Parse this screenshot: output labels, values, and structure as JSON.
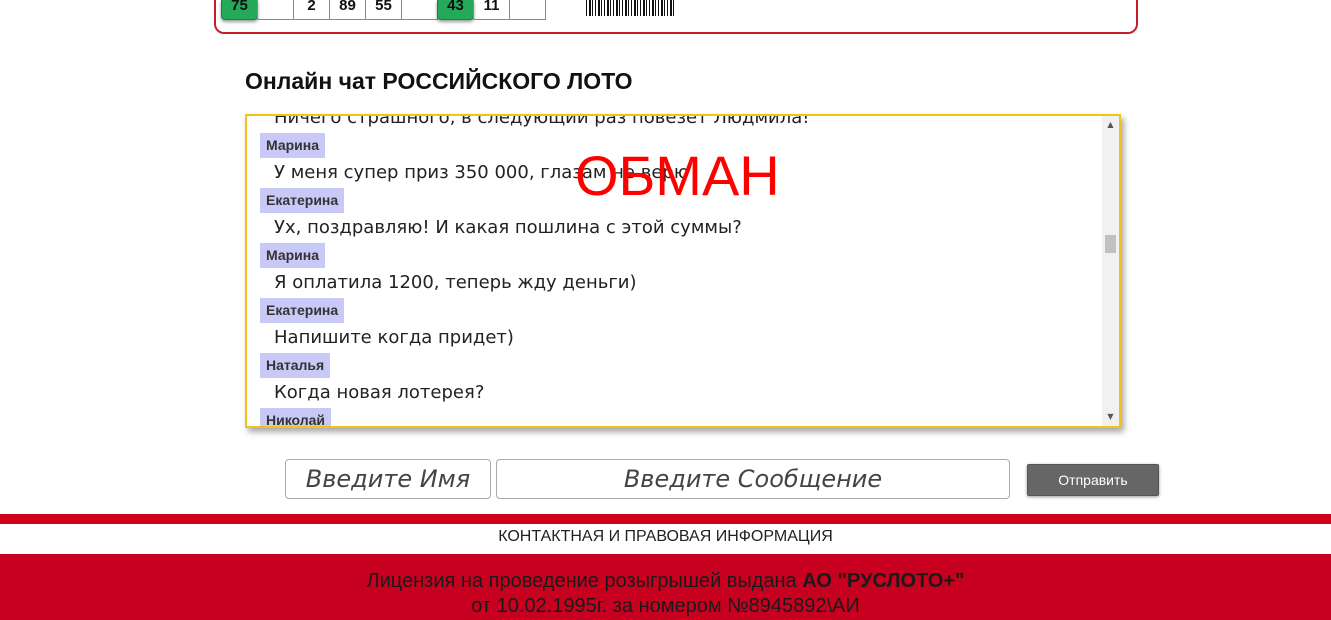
{
  "ticket": {
    "cells": [
      "75",
      "",
      "2",
      "89",
      "55",
      "",
      "43",
      "11",
      ""
    ],
    "hit_cells": [
      0,
      6
    ]
  },
  "chat": {
    "title": "Онлайн чат РОССИЙСКОГО ЛОТО",
    "first_text": "Ничего страшного, в следующий раз повезет Людмила!",
    "messages": [
      {
        "author": "Марина",
        "text": "У меня супер приз 350 000, глазам не верю"
      },
      {
        "author": "Екатерина",
        "text": "Ух, поздравляю! И какая пошлина с этой суммы?"
      },
      {
        "author": "Марина",
        "text": "Я оплатила 1200, теперь жду деньги)"
      },
      {
        "author": "Екатерина",
        "text": "Напишите когда придет)"
      },
      {
        "author": "Наталья",
        "text": "Когда новая лотерея?"
      },
      {
        "author": "Николай",
        "text": ""
      }
    ],
    "watermark": "ОБМАН",
    "author_bg": "#c9c9f7",
    "border_color": "#f2c21b"
  },
  "form": {
    "name_placeholder": "Введите Имя",
    "message_placeholder": "Введите Сообщение",
    "send_label": "Отправить"
  },
  "footer": {
    "contact_link": "КОНТАКТНАЯ И ПРАВОВАЯ ИНФОРМАЦИЯ",
    "license_prefix": "Лицензия на проведение розыгрышей выдана ",
    "license_org": "АО \"РУСЛОТО+\"",
    "license_line2": "от 10.02.1995г. за номером №8945892\\АИ",
    "brand_color": "#c8001f"
  }
}
